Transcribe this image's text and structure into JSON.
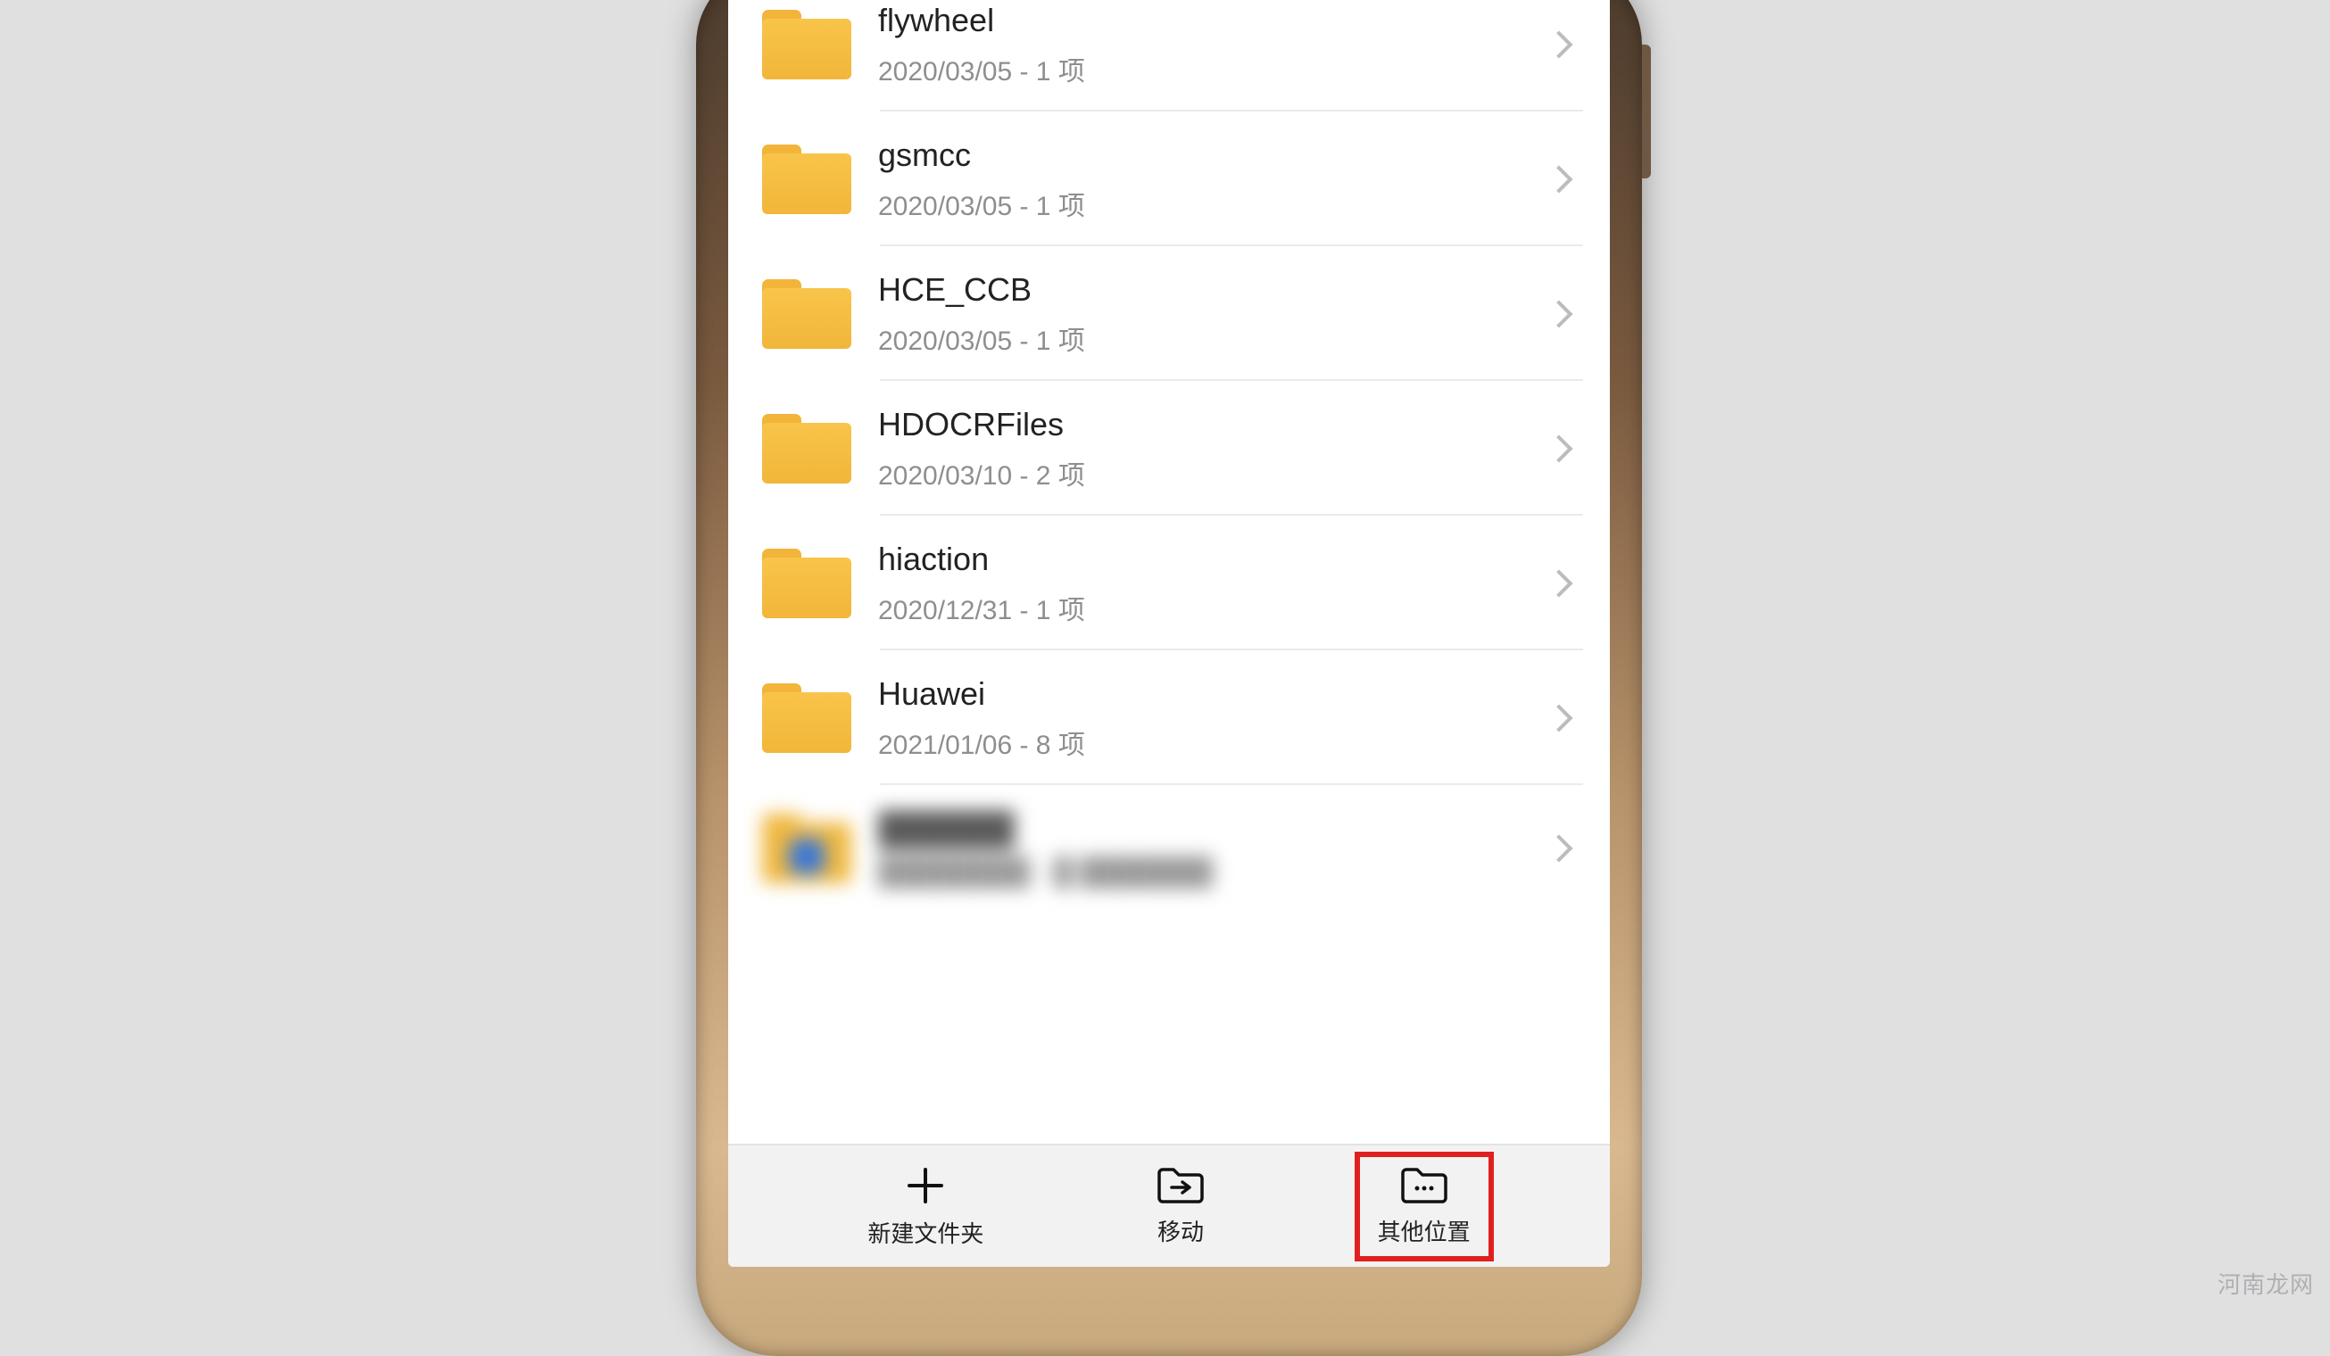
{
  "watermark": "河南龙网",
  "folders": [
    {
      "name": "flywheel",
      "meta": "2020/03/05 - 1 项"
    },
    {
      "name": "gsmcc",
      "meta": "2020/03/05 - 1 项"
    },
    {
      "name": "HCE_CCB",
      "meta": "2020/03/05 - 1 项"
    },
    {
      "name": "HDOCRFiles",
      "meta": "2020/03/10 - 2 项"
    },
    {
      "name": "hiaction",
      "meta": "2020/12/31 - 1 项"
    },
    {
      "name": "Huawei",
      "meta": "2021/01/06 - 8 项"
    }
  ],
  "blurred_row": {
    "name": "██████",
    "meta": "████████ - █ ███████"
  },
  "bottom": {
    "new_folder": "新建文件夹",
    "move": "移动",
    "other_location": "其他位置"
  }
}
